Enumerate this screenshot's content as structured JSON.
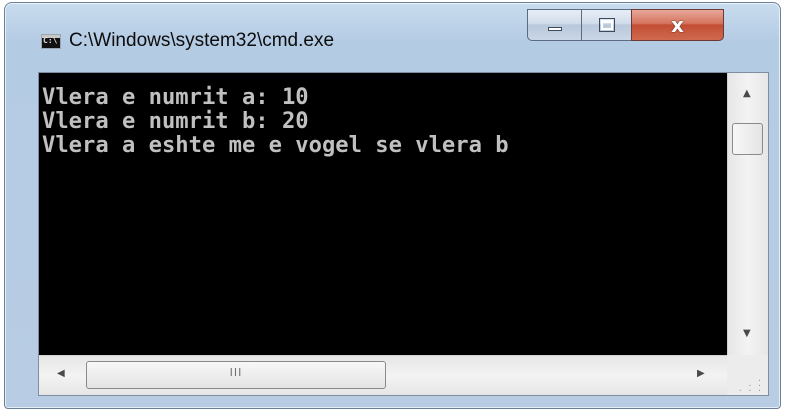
{
  "window": {
    "title": "C:\\Windows\\system32\\cmd.exe",
    "icon": "console-app-icon",
    "icon_text": "C:\\"
  },
  "caption_buttons": {
    "minimize_icon": "minimize-icon",
    "maximize_icon": "maximize-icon",
    "close_icon": "close-icon",
    "close_glyph": "x"
  },
  "console": {
    "background": "#000000",
    "text_color": "#c0c0c0",
    "lines": [
      "Vlera e numrit a: 10",
      "Vlera e numrit b: 20",
      "Vlera a eshte me e vogel se vlera b"
    ]
  },
  "scrollbars": {
    "up_arrow": "▲",
    "down_arrow": "▼",
    "left_arrow": "◀",
    "right_arrow": "▶",
    "h_grip": "III"
  }
}
